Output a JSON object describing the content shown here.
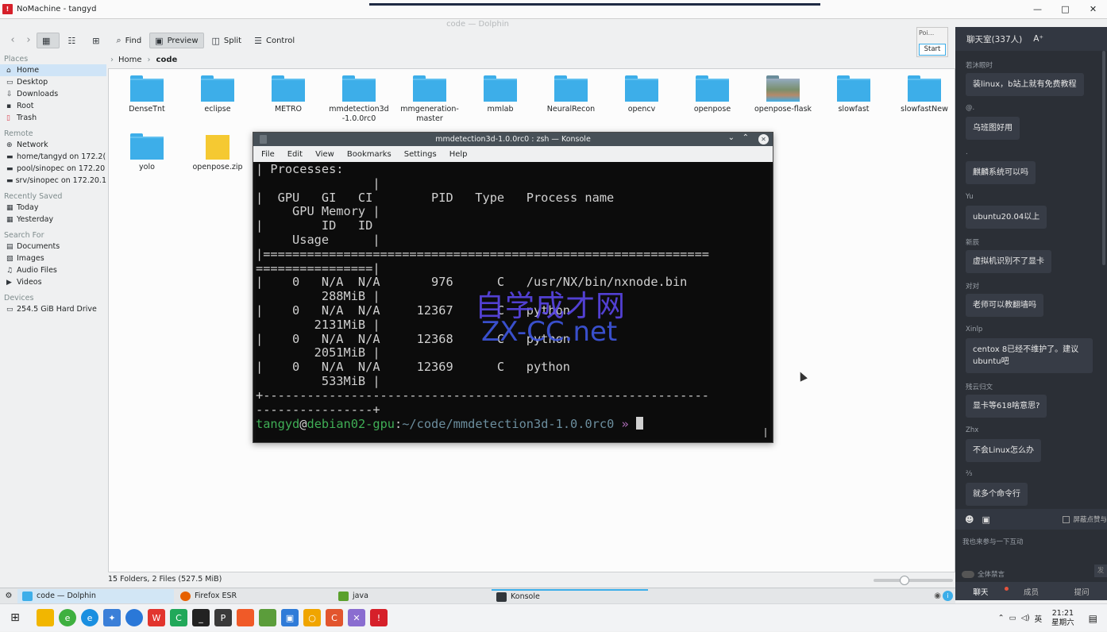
{
  "nomachine": {
    "title": "NoMachine - tangyd",
    "ctrl_min": "—",
    "ctrl_max": "□",
    "ctrl_close": "✕"
  },
  "dolphin": {
    "window_title": "code — Dolphin",
    "toolbar": {
      "find": "Find",
      "preview": "Preview",
      "split": "Split",
      "control": "Control"
    },
    "places": {
      "sections": [
        {
          "title": "Places",
          "items": [
            "Home",
            "Desktop",
            "Downloads",
            "Root",
            "Trash"
          ]
        },
        {
          "title": "Remote",
          "items": [
            "Network",
            "home/tangyd on 172.2(",
            "pool/sinopec on 172.20",
            "srv/sinopec on 172.20.1"
          ]
        },
        {
          "title": "Recently Saved",
          "items": [
            "Today",
            "Yesterday"
          ]
        },
        {
          "title": "Search For",
          "items": [
            "Documents",
            "Images",
            "Audio Files",
            "Videos"
          ]
        },
        {
          "title": "Devices",
          "items": [
            "254.5 GiB Hard Drive"
          ]
        }
      ]
    },
    "breadcrumb": {
      "home": "Home",
      "current": "code"
    },
    "files": [
      "DenseTnt",
      "eclipse",
      "METRO",
      "mmdetection3d\n-1.0.0rc0",
      "mmgeneration-\nmaster",
      "mmlab",
      "NeuralRecon",
      "opencv",
      "openpose",
      "openpose-flask",
      "slowfast",
      "slowfastNew",
      "yolo",
      "openpose.zip"
    ],
    "status": "15 Folders, 2 Files (527.5 MiB)"
  },
  "popup": {
    "label": "Poi...",
    "start": "Start"
  },
  "konsole": {
    "title": "mmdetection3d-1.0.0rc0 : zsh — Konsole",
    "menu": [
      "File",
      "Edit",
      "View",
      "Bookmarks",
      "Settings",
      "Help"
    ],
    "lines": [
      "| Processes:",
      "                |",
      "|  GPU   GI   CI        PID   Type   Process name",
      "     GPU Memory |",
      "|        ID   ID",
      "     Usage      |",
      "|=============================================================",
      "================|",
      "|    0   N/A  N/A       976      C   /usr/NX/bin/nxnode.bin",
      "         288MiB |",
      "|    0   N/A  N/A     12367      C   python",
      "        2131MiB |",
      "|    0   N/A  N/A     12368      C   python",
      "        2051MiB |",
      "|    0   N/A  N/A     12369      C   python",
      "         533MiB |",
      "+-------------------------------------------------------------",
      "----------------+"
    ],
    "prompt_user": "tangyd",
    "prompt_at": "@",
    "prompt_host": "debian02-gpu",
    "prompt_colon": ":",
    "prompt_path": "~/code/mmdetection3d-1.0.0rc0",
    "prompt_arrow": " » "
  },
  "watermark": {
    "line1": "自学成才网",
    "line2": "ZX-CC.net"
  },
  "chat": {
    "header": "聊天室(337人)",
    "font_btn": "A⁺",
    "messages": [
      {
        "name": "若沐眼时",
        "text": "装linux，b站上就有免费教程"
      },
      {
        "name": "@.",
        "text": "乌班图好用"
      },
      {
        "name": ".",
        "text": "麒麟系统可以吗"
      },
      {
        "name": "Yu",
        "text": "ubuntu20.04以上"
      },
      {
        "name": "新辰",
        "text": "虚拟机识别不了显卡"
      },
      {
        "name": "对对",
        "text": "老师可以教翻墙吗"
      },
      {
        "name": "Xinlp",
        "text": "centox 8已经不维护了。建议\nubuntu吧"
      },
      {
        "name": "残云归文",
        "text": "显卡等618啥意思?"
      },
      {
        "name": "Zhx",
        "text": "不会Linux怎么办"
      },
      {
        "name": "⅔",
        "text": "就多个命令行"
      }
    ],
    "screen_toggle": "屏蔽点赞与",
    "hint": "我也来参与一下互动",
    "mute": "全体禁言",
    "send": "发",
    "tabs": [
      "聊天",
      "成员",
      "提问"
    ]
  },
  "taskbar": {
    "items": [
      "code — Dolphin",
      "Firefox ESR",
      "java",
      "Konsole"
    ]
  },
  "tray": {
    "lang": "英",
    "time": "21:21",
    "day": "星期六"
  }
}
